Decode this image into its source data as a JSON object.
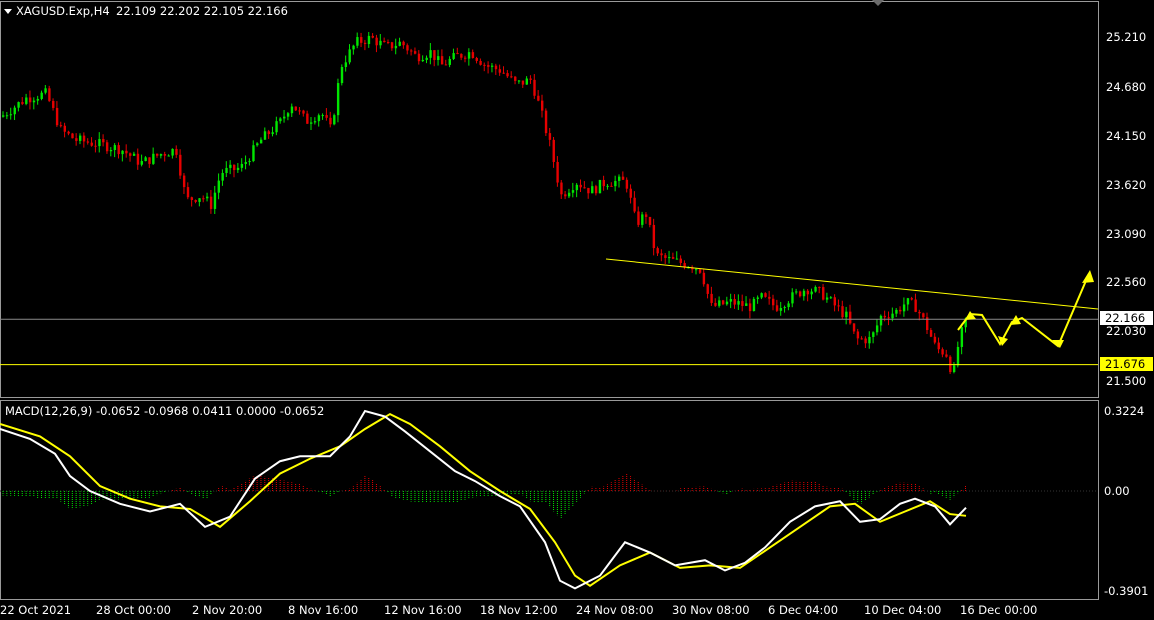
{
  "header": {
    "symbol": "XAGUSD.Exp,H4",
    "ohlc": "22.109 22.202 22.105 22.166"
  },
  "macd_header": {
    "label": "MACD(12,26,9) -0.0652 -0.0968 0.0411 0.0000 -0.0652"
  },
  "price_axis": {
    "ticks": [
      "25.210",
      "24.680",
      "24.150",
      "23.620",
      "23.090",
      "22.560",
      "22.030",
      "21.500"
    ],
    "tick_values": [
      25.21,
      24.68,
      24.15,
      23.62,
      23.09,
      22.56,
      22.03,
      21.5
    ],
    "current_price": "22.166",
    "support_level": "21.676",
    "range": [
      21.44,
      25.35
    ]
  },
  "macd_axis": {
    "ticks": [
      "0.3224",
      "0.00",
      "-0.3901"
    ],
    "tick_values": [
      0.3224,
      0.0,
      -0.3901
    ]
  },
  "time_axis": {
    "labels": [
      "22 Oct 2021",
      "28 Oct 00:00",
      "2 Nov 20:00",
      "8 Nov 16:00",
      "12 Nov 16:00",
      "18 Nov 12:00",
      "24 Nov 08:00",
      "30 Nov 08:00",
      "6 Dec 04:00",
      "10 Dec 04:00",
      "16 Dec 00:00"
    ]
  },
  "colors": {
    "background": "#000000",
    "bull": "#00e600",
    "bear": "#e60000",
    "trendline": "#ffff00",
    "arrow": "#ffff00",
    "macd_line": "#ffffff",
    "signal_line": "#ffff00",
    "grid_separator": "#9a9a9a",
    "label_bg_current": "#ffffff",
    "label_bg_support": "#ffff00"
  },
  "chart_data": {
    "type": "candlestick",
    "symbol": "XAGUSD.Exp",
    "timeframe": "H4",
    "close_path": [
      [
        0,
        24.35
      ],
      [
        25,
        24.55
      ],
      [
        45,
        24.6
      ],
      [
        60,
        24.2
      ],
      [
        75,
        24.1
      ],
      [
        100,
        24.05
      ],
      [
        120,
        24.0
      ],
      [
        140,
        23.85
      ],
      [
        160,
        23.95
      ],
      [
        175,
        24.0
      ],
      [
        185,
        23.45
      ],
      [
        200,
        23.5
      ],
      [
        210,
        23.4
      ],
      [
        220,
        23.75
      ],
      [
        240,
        23.8
      ],
      [
        260,
        24.1
      ],
      [
        280,
        24.3
      ],
      [
        290,
        24.5
      ],
      [
        305,
        24.3
      ],
      [
        320,
        24.4
      ],
      [
        330,
        24.2
      ],
      [
        340,
        24.9
      ],
      [
        355,
        25.15
      ],
      [
        370,
        25.2
      ],
      [
        385,
        25.1
      ],
      [
        400,
        25.15
      ],
      [
        415,
        25.0
      ],
      [
        430,
        25.05
      ],
      [
        440,
        24.9
      ],
      [
        455,
        25.0
      ],
      [
        470,
        25.05
      ],
      [
        485,
        24.9
      ],
      [
        500,
        24.85
      ],
      [
        515,
        24.7
      ],
      [
        530,
        24.75
      ],
      [
        540,
        24.4
      ],
      [
        550,
        24.0
      ],
      [
        560,
        23.5
      ],
      [
        575,
        23.65
      ],
      [
        590,
        23.55
      ],
      [
        605,
        23.65
      ],
      [
        625,
        23.65
      ],
      [
        635,
        23.2
      ],
      [
        645,
        23.3
      ],
      [
        655,
        22.85
      ],
      [
        670,
        22.8
      ],
      [
        690,
        22.75
      ],
      [
        700,
        22.7
      ],
      [
        710,
        22.3
      ],
      [
        730,
        22.35
      ],
      [
        750,
        22.3
      ],
      [
        760,
        22.4
      ],
      [
        775,
        22.3
      ],
      [
        790,
        22.4
      ],
      [
        805,
        22.5
      ],
      [
        820,
        22.45
      ],
      [
        835,
        22.3
      ],
      [
        845,
        22.2
      ],
      [
        855,
        21.95
      ],
      [
        870,
        21.95
      ],
      [
        880,
        22.2
      ],
      [
        895,
        22.25
      ],
      [
        905,
        22.35
      ],
      [
        915,
        22.3
      ],
      [
        925,
        22.1
      ],
      [
        935,
        21.85
      ],
      [
        945,
        21.8
      ],
      [
        952,
        21.55
      ],
      [
        958,
        21.95
      ],
      [
        966,
        22.166
      ]
    ],
    "price_ticks": [
      25.21,
      24.68,
      24.15,
      23.62,
      23.09,
      22.56,
      22.03,
      21.5
    ],
    "current_price": 22.166,
    "support_level": 21.676,
    "macd": {
      "params": "12,26,9",
      "values": [
        -0.0652,
        -0.0968,
        0.0411,
        0.0,
        -0.0652
      ],
      "macd_path": [
        [
          0,
          0.25
        ],
        [
          30,
          0.21
        ],
        [
          55,
          0.15
        ],
        [
          70,
          0.06
        ],
        [
          90,
          0.0
        ],
        [
          120,
          -0.05
        ],
        [
          150,
          -0.08
        ],
        [
          180,
          -0.05
        ],
        [
          205,
          -0.14
        ],
        [
          230,
          -0.1
        ],
        [
          255,
          0.05
        ],
        [
          280,
          0.12
        ],
        [
          300,
          0.14
        ],
        [
          330,
          0.14
        ],
        [
          350,
          0.22
        ],
        [
          365,
          0.3224
        ],
        [
          385,
          0.3
        ],
        [
          405,
          0.24
        ],
        [
          430,
          0.16
        ],
        [
          455,
          0.08
        ],
        [
          475,
          0.04
        ],
        [
          500,
          -0.02
        ],
        [
          520,
          -0.06
        ],
        [
          545,
          -0.2
        ],
        [
          560,
          -0.35
        ],
        [
          575,
          -0.38
        ],
        [
          600,
          -0.33
        ],
        [
          625,
          -0.2
        ],
        [
          650,
          -0.24
        ],
        [
          675,
          -0.29
        ],
        [
          705,
          -0.27
        ],
        [
          725,
          -0.31
        ],
        [
          745,
          -0.28
        ],
        [
          765,
          -0.22
        ],
        [
          790,
          -0.12
        ],
        [
          815,
          -0.06
        ],
        [
          840,
          -0.04
        ],
        [
          860,
          -0.12
        ],
        [
          880,
          -0.11
        ],
        [
          900,
          -0.05
        ],
        [
          915,
          -0.03
        ],
        [
          935,
          -0.06
        ],
        [
          950,
          -0.13
        ],
        [
          966,
          -0.0652
        ]
      ],
      "signal_path": [
        [
          0,
          0.27
        ],
        [
          40,
          0.22
        ],
        [
          70,
          0.14
        ],
        [
          100,
          0.02
        ],
        [
          130,
          -0.03
        ],
        [
          160,
          -0.06
        ],
        [
          190,
          -0.07
        ],
        [
          220,
          -0.14
        ],
        [
          250,
          -0.04
        ],
        [
          280,
          0.07
        ],
        [
          310,
          0.13
        ],
        [
          340,
          0.18
        ],
        [
          365,
          0.25
        ],
        [
          390,
          0.31
        ],
        [
          410,
          0.27
        ],
        [
          440,
          0.18
        ],
        [
          470,
          0.08
        ],
        [
          500,
          0.0
        ],
        [
          530,
          -0.07
        ],
        [
          555,
          -0.2
        ],
        [
          575,
          -0.33
        ],
        [
          590,
          -0.37
        ],
        [
          620,
          -0.29
        ],
        [
          650,
          -0.24
        ],
        [
          680,
          -0.3
        ],
        [
          710,
          -0.29
        ],
        [
          740,
          -0.3
        ],
        [
          770,
          -0.22
        ],
        [
          800,
          -0.14
        ],
        [
          830,
          -0.06
        ],
        [
          855,
          -0.05
        ],
        [
          880,
          -0.12
        ],
        [
          905,
          -0.08
        ],
        [
          930,
          -0.04
        ],
        [
          950,
          -0.09
        ],
        [
          966,
          -0.0968
        ]
      ]
    }
  }
}
